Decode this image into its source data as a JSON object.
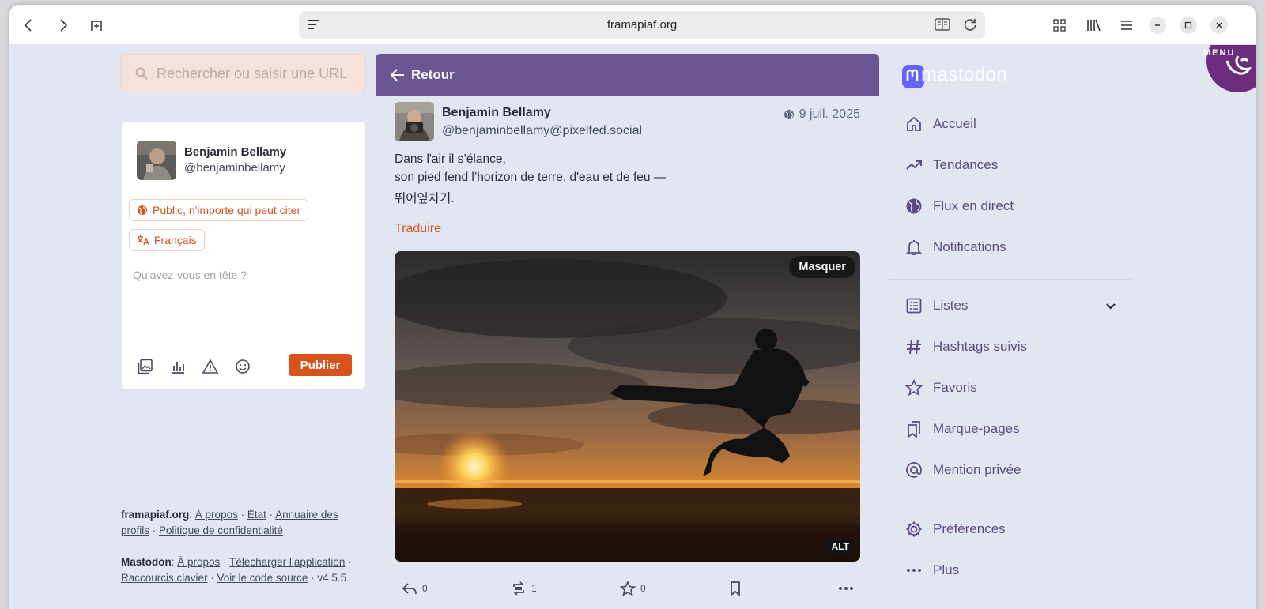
{
  "browser": {
    "url": "framapiaf.org"
  },
  "search": {
    "placeholder": "Rechercher ou saisir une URL"
  },
  "compose": {
    "user_name": "Benjamin Bellamy",
    "user_handle": "@benjaminbellamy",
    "visibility_label": "Public, n'importe qui peut citer",
    "language_label": "Français",
    "placeholder": "Qu’avez-vous en tête ?",
    "publish_label": "Publier"
  },
  "footer": {
    "server": {
      "name": "framapiaf.org",
      "links": [
        "À propos",
        "État",
        "Annuaire des profils",
        "Politique de confidentialité"
      ]
    },
    "mastodon": {
      "name": "Mastodon",
      "links": [
        "À propos",
        "Télécharger l’application",
        "Raccourcis clavier",
        "Voir le code source"
      ],
      "version": "v4.5.5"
    }
  },
  "column": {
    "back_label": "Retour"
  },
  "status": {
    "author_name": "Benjamin Bellamy",
    "author_handle": "@benjaminbellamy@pixelfed.social",
    "date": "9 juil. 2025",
    "lines": [
      "Dans l'air il s’élance,",
      "son pied fend l’horizon de terre, d'eau et de feu —",
      "뛰어옆차기."
    ],
    "translate_label": "Traduire",
    "media": {
      "hide_label": "Masquer",
      "alt_label": "ALT"
    },
    "actions": {
      "replies": "0",
      "boosts": "1",
      "favourites": "0"
    }
  },
  "brand": {
    "logo_text": "mastodon",
    "menu_badge": "MENU"
  },
  "nav": {
    "items": [
      {
        "label": "Accueil",
        "icon": "home-icon"
      },
      {
        "label": "Tendances",
        "icon": "trending-icon"
      },
      {
        "label": "Flux en direct",
        "icon": "globe-icon"
      },
      {
        "label": "Notifications",
        "icon": "bell-icon"
      },
      {
        "label": "Listes",
        "icon": "list-icon"
      },
      {
        "label": "Hashtags suivis",
        "icon": "hashtag-icon"
      },
      {
        "label": "Favoris",
        "icon": "star-icon"
      },
      {
        "label": "Marque-pages",
        "icon": "bookmarks-icon"
      },
      {
        "label": "Mention privée",
        "icon": "at-icon"
      },
      {
        "label": "Préférences",
        "icon": "gear-icon"
      },
      {
        "label": "Plus",
        "icon": "more-icon"
      }
    ]
  },
  "colors": {
    "accent": "#d8521b",
    "header_purple": "#6b5593",
    "nav_text": "#5d4a86",
    "background": "#e2e6f0"
  }
}
